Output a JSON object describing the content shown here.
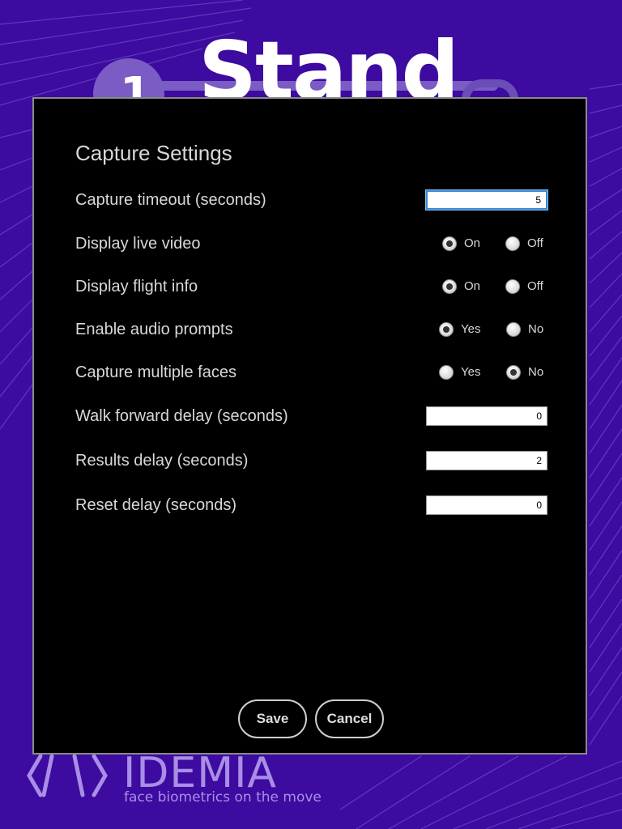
{
  "background": {
    "step_number": "1",
    "title": "Stand",
    "brand": "IDEMIA",
    "tagline": "face biometrics on the move",
    "accent_color": "#3d0ba0"
  },
  "dialog": {
    "title": "Capture Settings",
    "rows": {
      "capture_timeout": {
        "label": "Capture timeout (seconds)",
        "value": "5"
      },
      "display_live_video": {
        "label": "Display live video",
        "option_a": "On",
        "option_b": "Off",
        "selected": "On"
      },
      "display_flight_info": {
        "label": "Display flight info",
        "option_a": "On",
        "option_b": "Off",
        "selected": "On"
      },
      "enable_audio_prompts": {
        "label": "Enable audio prompts",
        "option_a": "Yes",
        "option_b": "No",
        "selected": "Yes"
      },
      "capture_multiple_faces": {
        "label": "Capture multiple faces",
        "option_a": "Yes",
        "option_b": "No",
        "selected": "No"
      },
      "walk_forward_delay": {
        "label": "Walk forward delay (seconds)",
        "value": "0"
      },
      "results_delay": {
        "label": "Results delay (seconds)",
        "value": "2"
      },
      "reset_delay": {
        "label": "Reset delay (seconds)",
        "value": "0"
      }
    },
    "save_label": "Save",
    "cancel_label": "Cancel"
  }
}
